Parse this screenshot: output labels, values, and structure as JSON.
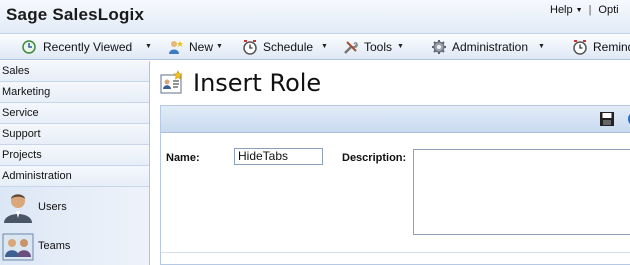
{
  "header": {
    "brand": "Sage SalesLogix",
    "help_label": "Help",
    "separator": "|",
    "options_label": "Opti"
  },
  "toolbar": {
    "items": [
      {
        "label": "Recently Viewed",
        "icon": "recently-viewed-icon"
      },
      {
        "label": "New",
        "icon": "new-icon"
      },
      {
        "label": "Schedule",
        "icon": "schedule-icon"
      },
      {
        "label": "Tools",
        "icon": "tools-icon"
      },
      {
        "label": "Administration",
        "icon": "administration-icon"
      },
      {
        "label": "Reminde",
        "icon": "reminder-icon"
      }
    ]
  },
  "sidebar": {
    "items": [
      {
        "label": "Sales"
      },
      {
        "label": "Marketing"
      },
      {
        "label": "Service"
      },
      {
        "label": "Support"
      },
      {
        "label": "Projects"
      },
      {
        "label": "Administration"
      }
    ],
    "admin_entries": [
      {
        "label": "Users",
        "icon": "user-icon"
      },
      {
        "label": "Teams",
        "icon": "teams-icon"
      }
    ]
  },
  "main": {
    "title": "Insert Role",
    "title_icon": "role-icon",
    "form": {
      "name_label": "Name:",
      "name_value": "HideTabs",
      "description_label": "Description:",
      "description_value": ""
    },
    "actions": {
      "save_icon": "save-icon",
      "help_icon": "help-icon"
    }
  },
  "colors": {
    "toolbar_bg": "#dfe8f5",
    "panel_bar": "#c9daf0",
    "border": "#aec3e0"
  }
}
